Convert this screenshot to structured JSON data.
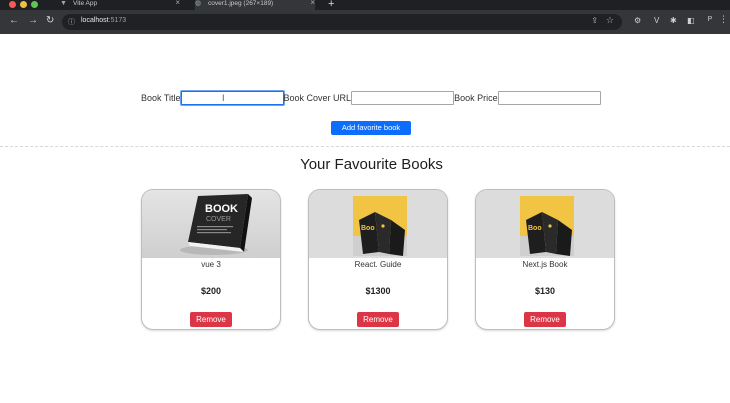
{
  "browser": {
    "tabs": [
      {
        "title": "Vite App",
        "icon": "vite-favicon-icon",
        "active": false
      },
      {
        "title": "cover1.jpeg (267×189)",
        "icon": "globe-icon",
        "active": true
      }
    ],
    "address": {
      "host": "localhost",
      "port": ":5173"
    },
    "profile_initial": "P"
  },
  "form": {
    "title_label": "Book Title",
    "title_value": "",
    "cover_label": "Book Cover URL",
    "cover_value": "",
    "price_label": "Book Price",
    "price_value": "",
    "submit_label": "Add favorite book"
  },
  "section_title": "Your Favourite Books",
  "books": [
    {
      "name": "vue 3",
      "price": "$200",
      "cover": "book-cover-mockup-image",
      "remove_label": "Remove"
    },
    {
      "name": "React. Guide",
      "price": "$1300",
      "cover": "yellow-book-cover-image",
      "remove_label": "Remove"
    },
    {
      "name": "Next.js Book",
      "price": "$130",
      "cover": "yellow-book-cover-image",
      "remove_label": "Remove"
    }
  ],
  "colors": {
    "primary": "#0d6efd",
    "danger": "#dc3545",
    "chrome_bg": "#35363a",
    "tab_bar_bg": "#1f2024"
  }
}
